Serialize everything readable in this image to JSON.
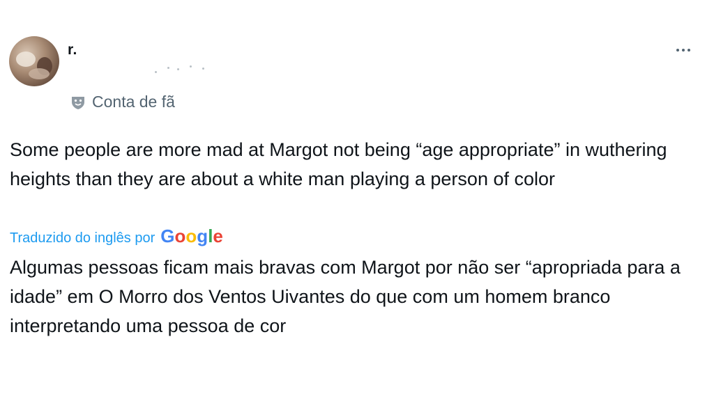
{
  "author": {
    "display_name": "r.",
    "badge_label": "Conta de fã",
    "avatar_icon": "avatar-photo",
    "badge_icon": "mask-icon"
  },
  "menu": {
    "more_icon": "more-options-icon"
  },
  "tweet": {
    "text": "Some people are more mad at Margot not being “age appropriate” in wuthering heights than they are about a white man playing a person of color",
    "translation_label": "Traduzido do inglês por",
    "translation_provider_letters": [
      "G",
      "o",
      "o",
      "g",
      "l",
      "e"
    ],
    "translation_provider_colors": [
      "#4285F4",
      "#EA4335",
      "#FBBC05",
      "#4285F4",
      "#34A853",
      "#EA4335"
    ],
    "translated_text": "Algumas pessoas ficam mais bravas com Margot por não ser “apropriada para a idade” em O Morro dos Ventos Uivantes do que com um homem branco interpretando uma pessoa de cor"
  },
  "colors": {
    "text_primary": "#0f1419",
    "text_secondary": "#536471",
    "link": "#1d9bf0"
  }
}
